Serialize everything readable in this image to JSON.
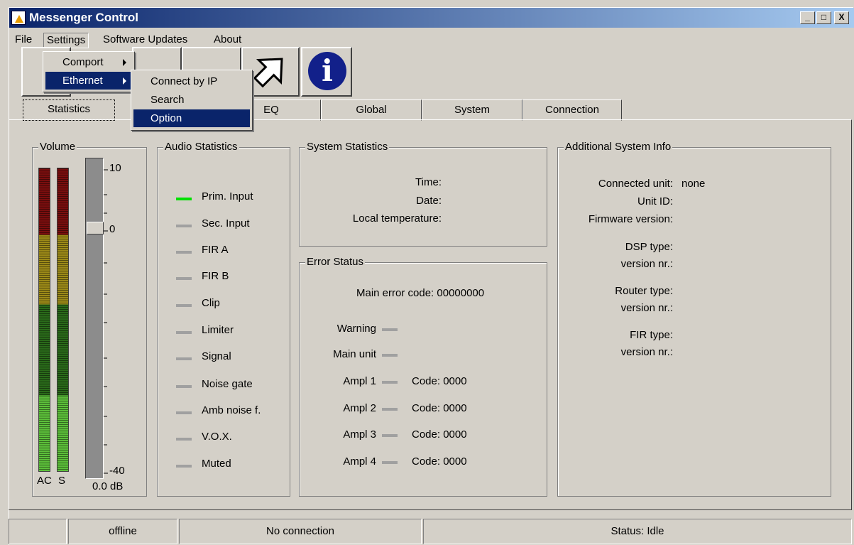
{
  "window": {
    "title": "Messenger Control",
    "minimize": "_",
    "maximize": "□",
    "close": "X"
  },
  "menu": {
    "file": "File",
    "settings": "Settings",
    "software_updates": "Software Updates",
    "about": "About"
  },
  "settings_menu": {
    "items": [
      {
        "label": "Comport"
      },
      {
        "label": "Ethernet"
      }
    ]
  },
  "ethernet_menu": {
    "items": [
      {
        "label": "Connect by IP"
      },
      {
        "label": "Search"
      },
      {
        "label": "Option"
      }
    ]
  },
  "toolbar": {
    "info_icon": "i"
  },
  "tabs": [
    {
      "label": "Statistics"
    },
    {
      "label": "EQ"
    },
    {
      "label": "Global"
    },
    {
      "label": "System"
    },
    {
      "label": "Connection"
    }
  ],
  "volume": {
    "title": "Volume",
    "scale_top": "10",
    "scale_mid": "0",
    "scale_bottom": "-40",
    "meter_labels": [
      "AC",
      "S"
    ],
    "value": "0.0 dB"
  },
  "audio_stats": {
    "title": "Audio Statistics",
    "items": [
      {
        "label": "Prim. Input",
        "on": true
      },
      {
        "label": "Sec. Input",
        "on": false
      },
      {
        "label": "FIR A",
        "on": false
      },
      {
        "label": "FIR B",
        "on": false
      },
      {
        "label": "Clip",
        "on": false
      },
      {
        "label": "Limiter",
        "on": false
      },
      {
        "label": "Signal",
        "on": false
      },
      {
        "label": "Noise gate",
        "on": false
      },
      {
        "label": "Amb noise f.",
        "on": false
      },
      {
        "label": "V.O.X.",
        "on": false
      },
      {
        "label": "Muted",
        "on": false
      }
    ]
  },
  "system_stats": {
    "title": "System Statistics",
    "time": "Time:",
    "date": "Date:",
    "temp": "Local temperature:"
  },
  "error_status": {
    "title": "Error Status",
    "main_error": "Main error code: 00000000",
    "warning": "Warning",
    "main_unit": "Main unit",
    "ampls": [
      {
        "label": "Ampl 1",
        "code": "Code: 0000"
      },
      {
        "label": "Ampl 2",
        "code": "Code: 0000"
      },
      {
        "label": "Ampl 3",
        "code": "Code: 0000"
      },
      {
        "label": "Ampl 4",
        "code": "Code: 0000"
      }
    ]
  },
  "additional": {
    "title": "Additional System Info",
    "connected_unit": "Connected unit:",
    "connected_value": "none",
    "unit_id": "Unit ID:",
    "firmware": "Firmware version:",
    "dsp": "DSP type:",
    "version1": "version nr.:",
    "router": "Router type:",
    "version2": "version nr.:",
    "fir": "FIR type:",
    "version3": "version nr.:"
  },
  "statusbar": {
    "connection_state": "offline",
    "connection_text": "No connection",
    "status": "Status: Idle"
  }
}
